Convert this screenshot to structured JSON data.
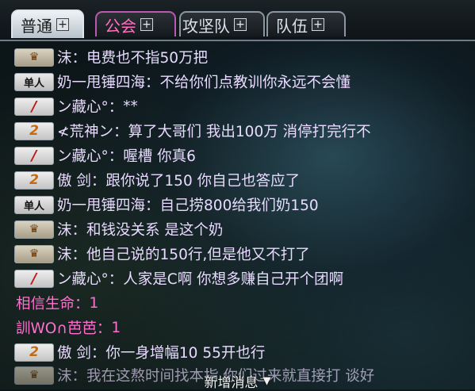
{
  "tabs": [
    {
      "label": "普通",
      "plus": "+",
      "active": true
    },
    {
      "label": "公会",
      "plus": "+",
      "active": false
    },
    {
      "label": "攻坚队",
      "plus": "+",
      "active": false
    },
    {
      "label": "队伍",
      "plus": "+",
      "active": false
    }
  ],
  "messages": [
    {
      "badge": "crown-badge",
      "name": "沫",
      "sep": "：",
      "text": "电费也不指50万把"
    },
    {
      "badge": "solo-badge",
      "badge_text": "单人",
      "name": "奶一甩锤四海",
      "sep": "：",
      "text": "不给你们点教训你永远不会懂"
    },
    {
      "badge": "slash-badge",
      "name": "ン藏心°",
      "sep": "：",
      "text": "**"
    },
    {
      "badge": "two-badge",
      "name": "≮荒神ン",
      "sep": "：",
      "text": "算了大哥们    我出100万  消停打完行不"
    },
    {
      "badge": "slash-badge",
      "name": "ン藏心°",
      "sep": "：",
      "text": "喔槽  你真6"
    },
    {
      "badge": "two-badge",
      "name": "傲 剑",
      "sep": "：",
      "text": "跟你说了150  你自己也答应了"
    },
    {
      "badge": "solo-badge",
      "badge_text": "单人",
      "name": "奶一甩锤四海",
      "sep": "：",
      "text": "自己捞800给我们奶150"
    },
    {
      "badge": "crown-badge",
      "name": "沫",
      "sep": "：",
      "text": "和钱没关系  是这个奶"
    },
    {
      "badge": "crown-badge",
      "name": "沫",
      "sep": "：",
      "text": "他自己说的150行,但是他又不打了"
    },
    {
      "badge": "slash-badge",
      "name": "ン藏心°",
      "sep": "：",
      "text": "人家是C啊      你想多赚自己开个团啊"
    },
    {
      "badge": "",
      "name": "相信生命",
      "sep": "：",
      "text": "1"
    },
    {
      "badge": "",
      "name": "訓WO∩芭芭",
      "sep": "：",
      "text": "1"
    },
    {
      "badge": "two-badge",
      "name": "傲 剑",
      "sep": "：",
      "text": "你一身增幅10  55开也行"
    },
    {
      "badge": "crown-badge",
      "name": "沫",
      "sep": "：",
      "text": "我在这熬时间找本指  你们过来就直接打  谈好"
    }
  ],
  "footer": {
    "label": "新增消息",
    "arrow": "▼"
  },
  "icons": {
    "crown": "♛",
    "slash": "/",
    "two": "2"
  },
  "colors": {
    "chat_text": "#e9dbff",
    "system_text": "#ff6fcf",
    "guild_tab": "#ff6fbf"
  }
}
